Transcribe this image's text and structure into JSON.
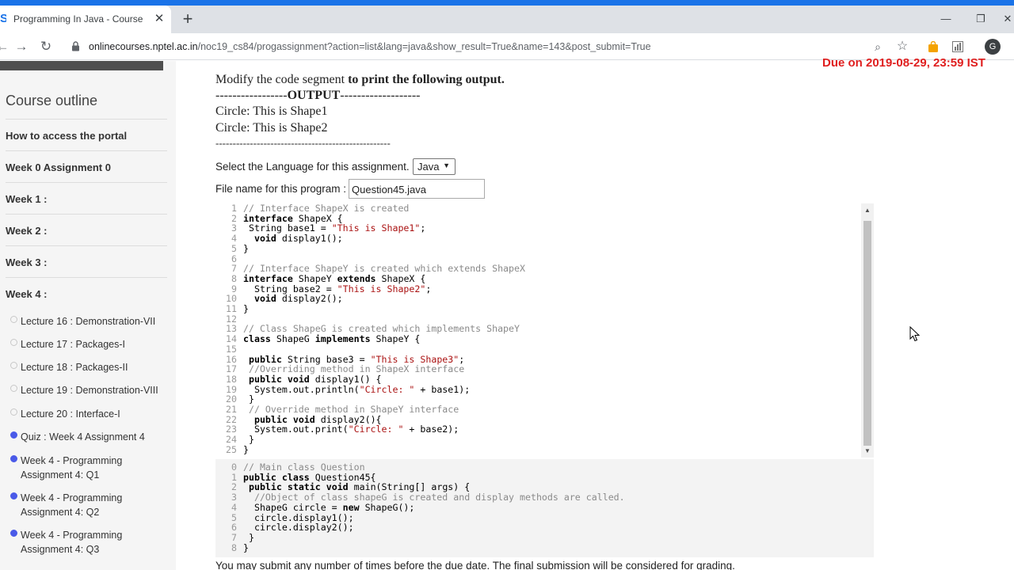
{
  "browser": {
    "tab_title": "Programming In Java - Course",
    "url_host": "onlinecourses.nptel.ac.in",
    "url_path": "/noc19_cs84/progassignment?action=list&lang=java&show_result=True&name=143&post_submit=True"
  },
  "sidebar": {
    "heading": "Course outline",
    "items": [
      "How to access the portal",
      "Week 0 Assignment 0",
      "Week 1 :",
      "Week 2 :",
      "Week 3 :",
      "Week 4 :"
    ],
    "lectures": [
      {
        "label": "Lecture 16 : Demonstration-VII",
        "done": false
      },
      {
        "label": "Lecture 17 : Packages-I",
        "done": false
      },
      {
        "label": "Lecture 18 : Packages-II",
        "done": false
      },
      {
        "label": "Lecture 19 : Demonstration-VIII",
        "done": false
      },
      {
        "label": "Lecture 20 : Interface-I",
        "done": false
      },
      {
        "label": "Quiz : Week 4 Assignment 4",
        "done": true
      },
      {
        "label": "Week 4 - Programming Assignment 4: Q1",
        "done": true
      },
      {
        "label": "Week 4 - Programming Assignment 4: Q2",
        "done": true
      },
      {
        "label": "Week 4 - Programming Assignment 4: Q3",
        "done": true
      }
    ]
  },
  "main": {
    "due": "Due on 2019-08-29, 23:59 IST",
    "instruction_pre": "Modify the code segment ",
    "instruction_bold": "to print the following output.",
    "output_header_left": "-----------------",
    "output_header_word": "OUTPUT",
    "output_header_right": "-------------------",
    "output_lines": [
      "Circle: This is Shape1",
      "Circle: This is Shape2"
    ],
    "output_footer": "---------------------------------------------------",
    "language_label": "Select the Language for this assignment.",
    "language_value": "Java",
    "file_label": "File name for this program :",
    "file_value": "Question45.java",
    "bottom_note": "You may submit any number of times before the due date. The final submission will be considered for grading."
  },
  "code_editable": [
    "// Interface ShapeX is created",
    "interface ShapeX {",
    " String base1 = \"This is Shape1\";",
    "  void display1();",
    "}",
    "",
    "// Interface ShapeY is created which extends ShapeX",
    "interface ShapeY extends ShapeX {",
    "  String base2 = \"This is Shape2\";",
    "  void display2();",
    "}",
    "",
    "// Class ShapeG is created which implements ShapeY",
    "class ShapeG implements ShapeY {",
    "",
    " public String base3 = \"This is Shape3\";",
    " //Overriding method in ShapeX interface",
    " public void display1() {",
    "  System.out.println(\"Circle: \" + base1);",
    " }",
    " // Override method in ShapeY interface",
    "  public void display2(){",
    "  System.out.print(\"Circle: \" + base2);",
    " }",
    "}"
  ],
  "code_locked": [
    "// Main class Question",
    "public class Question45{",
    " public static void main(String[] args) {",
    "  //Object of class shapeG is created and display methods are called.",
    "  ShapeG circle = new ShapeG();",
    "  circle.display1();",
    "  circle.display2();",
    " }",
    "}"
  ]
}
